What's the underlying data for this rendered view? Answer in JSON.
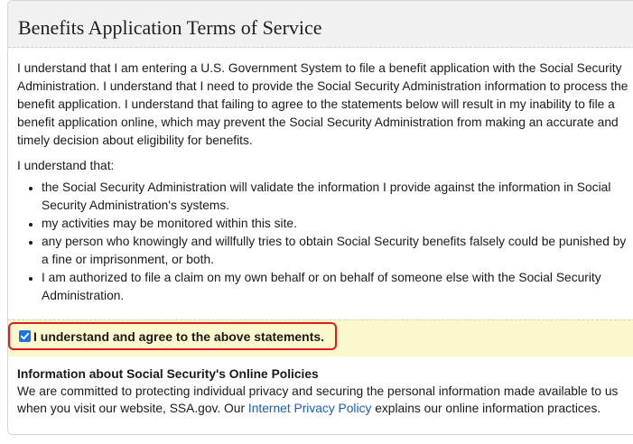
{
  "header": {
    "title": "Benefits Application Terms of Service"
  },
  "intro": "I understand that I am entering a U.S. Government System to file a benefit application with the Social Security Administration. I understand that I need to provide the Social Security Administration information to process the benefit application. I understand that failing to agree to the statements below will result in my inability to file a benefit application online, which may prevent the Social Security Administration from making an accurate and timely decision about eligibility for benefits.",
  "understand_that": "I understand that:",
  "statements": [
    "the Social Security Administration will validate the information I provide against the information in Social Security Administration's systems.",
    "my activities may be monitored within this site.",
    "any person who knowingly and willfully tries to obtain Social Security benefits falsely could be punished by a fine or imprisonment, or both.",
    "I am authorized to file a claim on my own behalf or on behalf of someone else with the Social Security Administration."
  ],
  "agree": {
    "label": "I understand and agree to the above statements.",
    "checked": true
  },
  "policies": {
    "title": "Information about Social Security's Online Policies",
    "text_before": "We are committed to protecting individual privacy and securing the personal information made available to us when you visit our website, SSA.gov. Our ",
    "link_text": "Internet Privacy Policy",
    "text_after": " explains our online information practices."
  },
  "colors": {
    "accent_red": "#e01b1b",
    "checkbox_blue": "#1a73e8",
    "link_blue": "#1a5fbf",
    "agree_bg": "#fcf8ce"
  }
}
